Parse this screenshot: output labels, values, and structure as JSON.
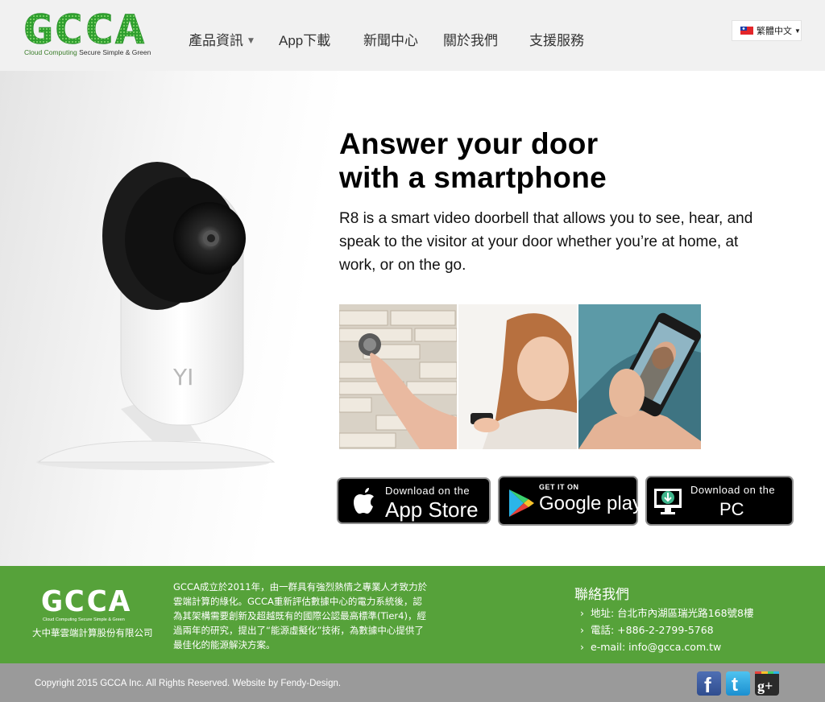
{
  "header": {
    "logo_text": "GCCA",
    "logo_tagline_green": "Cloud Computing",
    "logo_tagline_dark": "Secure Simple & Green",
    "nav": [
      {
        "label": "產品資訊",
        "has_dropdown": true
      },
      {
        "label": "App下載"
      },
      {
        "label": "新聞中心"
      },
      {
        "label": "關於我們"
      },
      {
        "label": "支援服務"
      }
    ],
    "language": {
      "selected": "繁體中文",
      "flag": "taiwan-flag"
    }
  },
  "hero": {
    "headline_line1": "Answer your door",
    "headline_line2": "with a smartphone",
    "description": "R8 is a smart video doorbell that allows you to see, hear, and speak to the visitor at your door whether you’re at home, at work, or on the go.",
    "camera_label": "YI",
    "photos": [
      "doorbell-press-photo",
      "woman-with-phone-photo",
      "phone-video-call-photo"
    ],
    "downloads": {
      "appstore_small": "Download on the",
      "appstore_big": "App Store",
      "googleplay_small": "GET IT ON",
      "googleplay_big": "Google play",
      "pc_small": "Download on the",
      "pc_big": "PC"
    }
  },
  "footer": {
    "logo_text": "GCCA",
    "logo_tagline": "Cloud Computing Secure Simple & Green",
    "company_name": "大中華雲端計算股份有限公司",
    "about": "GCCA成立於2011年，由一群具有強烈熱情之專業人才致力於雲端計算的綠化。GCCA重新評估數據中心的電力系統後，認為其架構需要創新及超越既有的國際公認最高標準(Tier4)，經過兩年的研究，提出了“能源虛擬化”技術，為數據中心提供了最佳化的能源解決方案。",
    "contact_title": "聯絡我們",
    "contact": [
      "地址: 台北市內湖區瑞光路168號8樓",
      "電話: +886-2-2799-5768",
      "e-mail: info@gcca.com.tw"
    ],
    "copyright": "Copyright 2015 GCCA  Inc.  All Rights Reserved. Website by Fendy-Design.",
    "social": [
      "facebook-icon",
      "twitter-icon",
      "google-plus-icon"
    ]
  },
  "colors": {
    "brand_green": "#56a23a",
    "logo_green": "#3cb83a",
    "header_bg": "#f1f1f1",
    "bottom_bar": "#9a9a9a"
  }
}
